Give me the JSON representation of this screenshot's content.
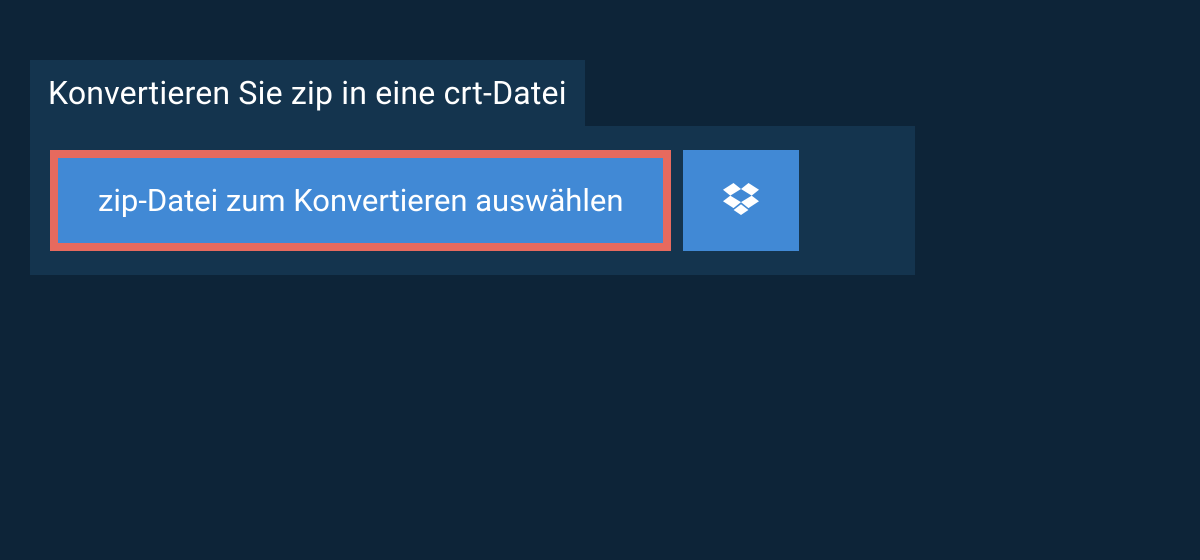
{
  "panel": {
    "title": "Konvertieren Sie zip in eine crt-Datei",
    "upload_button_label": "zip-Datei zum Konvertieren auswählen"
  },
  "colors": {
    "background": "#0d2438",
    "panel_bg": "#14344e",
    "button_bg": "#4189d5",
    "highlight_border": "#e66a5e",
    "text": "#ffffff"
  }
}
